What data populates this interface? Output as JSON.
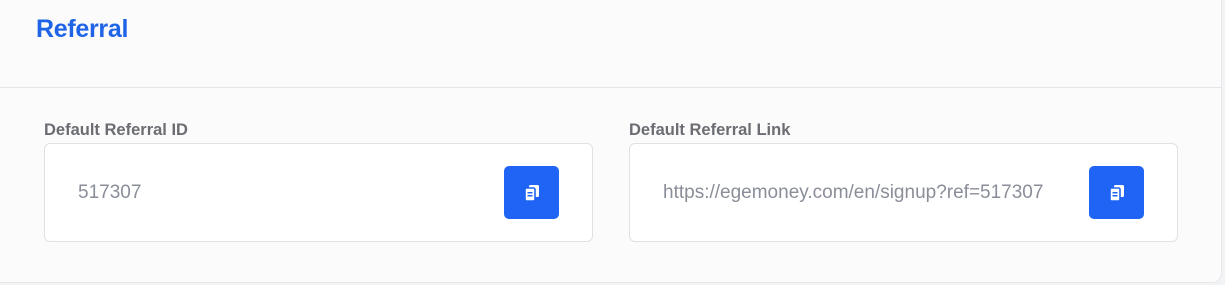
{
  "card": {
    "title": "Referral"
  },
  "referral_id": {
    "label": "Default Referral ID",
    "value": "517307",
    "copy_icon": "copy-icon"
  },
  "referral_link": {
    "label": "Default Referral Link",
    "value": "https://egemoney.com/en/signup?ref=517307",
    "copy_icon": "copy-icon"
  },
  "colors": {
    "accent": "#1f64e6",
    "button": "#1f64f4",
    "label": "#6b6d72",
    "value_text": "#8a8e99"
  }
}
